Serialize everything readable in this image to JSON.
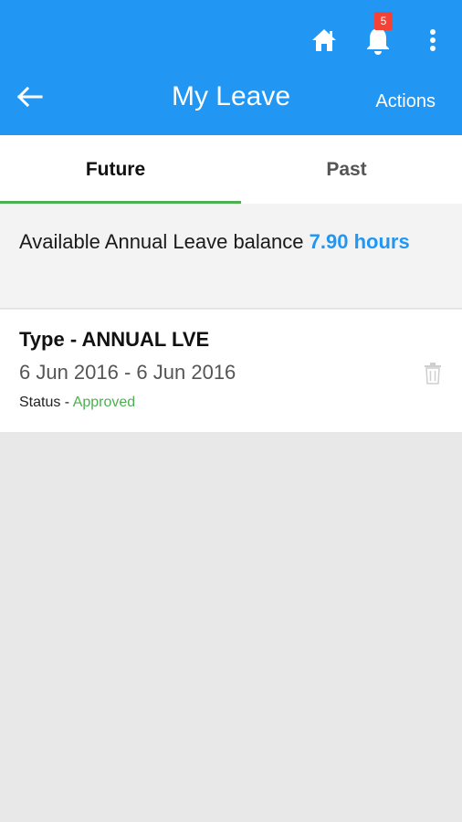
{
  "header": {
    "title": "My Leave",
    "actions_label": "Actions",
    "notification_count": "5",
    "accent_color": "#2196f3"
  },
  "tabs": [
    {
      "label": "Future",
      "active": true
    },
    {
      "label": "Past",
      "active": false
    }
  ],
  "balance": {
    "label": "Available Annual Leave balance",
    "value": "7.90 hours"
  },
  "leaves": [
    {
      "type": "Type - ANNUAL LVE",
      "dates": "6 Jun 2016 - 6 Jun 2016",
      "status_label": "Status - ",
      "status_value": "Approved"
    }
  ],
  "icons": {
    "home": "home-icon",
    "bell": "bell-icon",
    "more": "more-vert-icon",
    "back": "arrow-back-icon",
    "delete": "trash-icon"
  }
}
